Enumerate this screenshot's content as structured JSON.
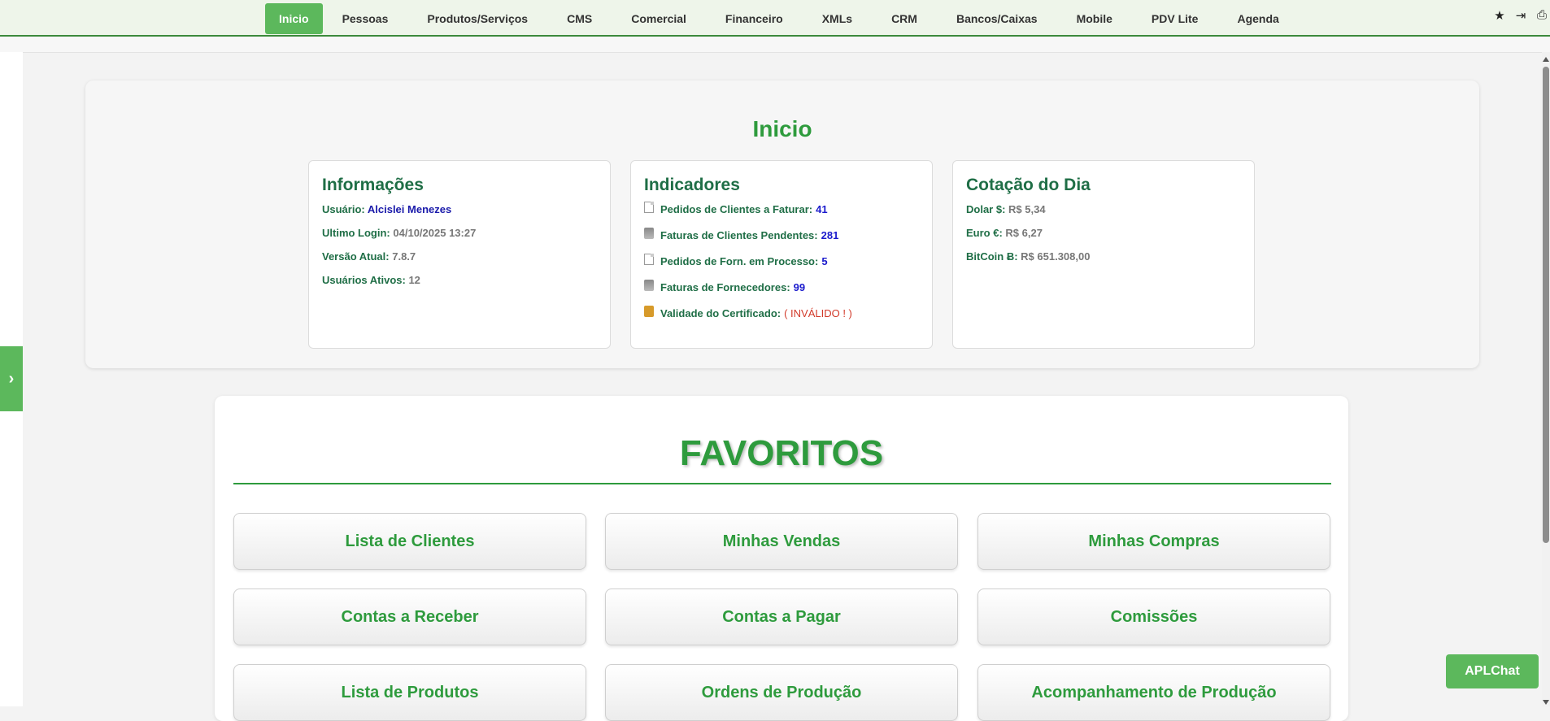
{
  "nav": {
    "items": [
      "Inicio",
      "Pessoas",
      "Produtos/Serviços",
      "CMS",
      "Comercial",
      "Financeiro",
      "XMLs",
      "CRM",
      "Bancos/Caixas",
      "Mobile",
      "PDV Lite",
      "Agenda"
    ],
    "active": "Inicio",
    "tools": [
      {
        "name": "star-icon",
        "glyph": "★"
      },
      {
        "name": "logout-icon",
        "glyph": "⇥"
      },
      {
        "name": "print-icon",
        "glyph": "⎙"
      }
    ]
  },
  "sidebar": {
    "toggle_glyph": "›"
  },
  "inicio": {
    "title": "Inicio",
    "info": {
      "title": "Informações",
      "usuario_label": "Usuário:",
      "usuario_value": "Alcislei Menezes",
      "login_label": "Ultimo Login:",
      "login_value": "04/10/2025 13:27",
      "versao_label": "Versão Atual:",
      "versao_value": "7.8.7",
      "ativos_label": "Usuários Ativos:",
      "ativos_value": "12"
    },
    "indicadores": {
      "title": "Indicadores",
      "items": [
        {
          "label": "Pedidos de Clientes a Faturar:",
          "value": "41",
          "icon": "document-icon"
        },
        {
          "label": "Faturas de Clientes Pendentes:",
          "value": "281",
          "icon": "database-icon"
        },
        {
          "label": "Pedidos de Forn. em Processo:",
          "value": "5",
          "icon": "document-icon"
        },
        {
          "label": "Faturas de Fornecedores:",
          "value": "99",
          "icon": "database-icon"
        },
        {
          "label": "Validade do Certificado:",
          "value": "( INVÁLIDO ! )",
          "icon": "lock-icon"
        }
      ]
    },
    "cotacao": {
      "title": "Cotação do Dia",
      "dolar_label": "Dolar $:",
      "dolar_value": "R$ 5,34",
      "euro_label": "Euro €:",
      "euro_value": "R$ 6,27",
      "btc_label": "BitCoin Ƀ:",
      "btc_value": "R$ 651.308,00"
    }
  },
  "favoritos": {
    "title": "FAVORITOS",
    "buttons": [
      "Lista de Clientes",
      "Minhas Vendas",
      "Minhas Compras",
      "Contas a Receber",
      "Contas a Pagar",
      "Comissões",
      "Lista de Produtos",
      "Ordens de Produção",
      "Acompanhamento de Produção"
    ]
  },
  "chat": {
    "label": "APLChat"
  },
  "colors": {
    "accent": "#5cb85c",
    "title_green": "#2e9b3d",
    "dark_green": "#1f6e46",
    "value_blue": "#1a1acc",
    "invalid_red": "#d23a2a"
  }
}
